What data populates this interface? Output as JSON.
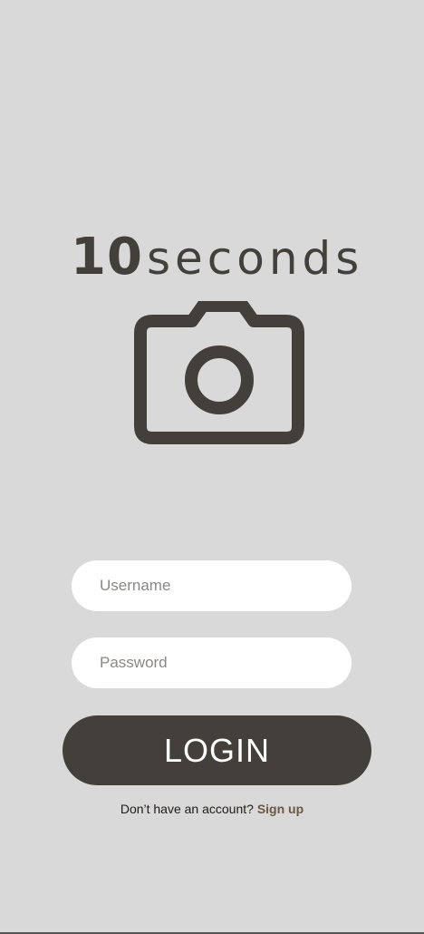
{
  "logo": {
    "number": "10",
    "word": "seconds"
  },
  "icons": {
    "camera": "camera-icon"
  },
  "form": {
    "username_placeholder": "Username",
    "password_placeholder": "Password",
    "login_label": "LOGIN"
  },
  "signup": {
    "prompt": "Don’t have an account? ",
    "link_label": "Sign up"
  },
  "colors": {
    "background": "#d9d9d9",
    "primary": "#433f3b",
    "link": "#6b5844",
    "field": "#ffffff"
  }
}
